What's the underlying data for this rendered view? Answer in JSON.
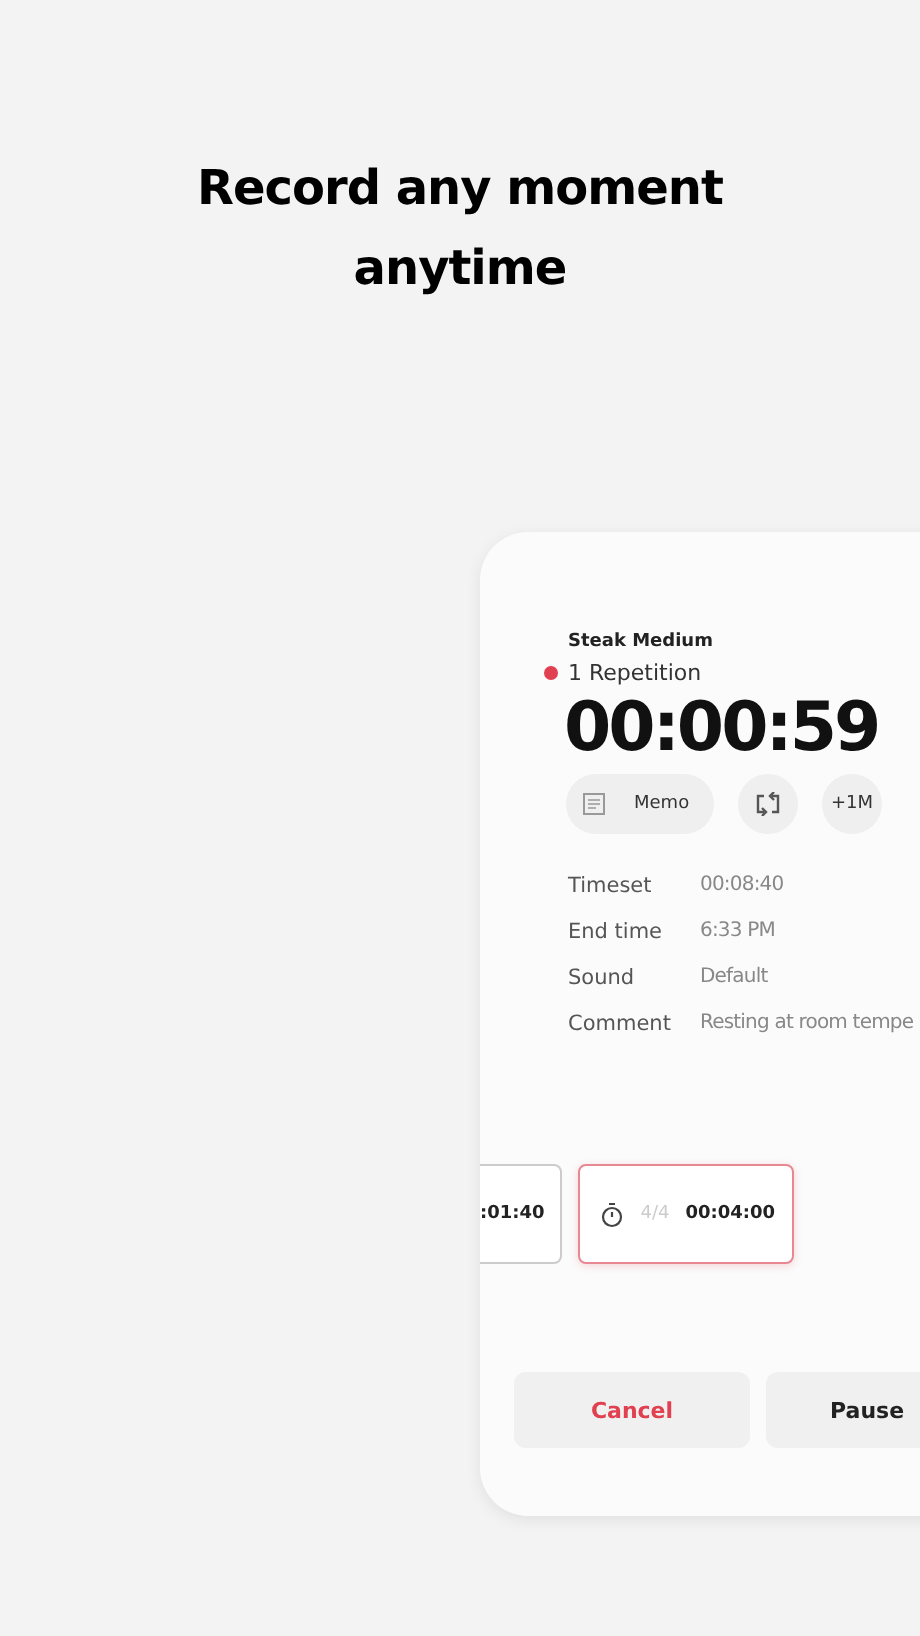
{
  "headline": [
    "Record any moment",
    "anytime"
  ],
  "timer": {
    "name": "Steak Medium",
    "repetition": "1 Repetition",
    "running": true,
    "time": "00:00:59"
  },
  "actions": [
    {
      "kind": "memo",
      "label": "Memo"
    },
    {
      "kind": "repeat"
    },
    {
      "kind": "text",
      "label": "+1M"
    }
  ],
  "details": [
    {
      "label": "Timeset",
      "value": "00:08:40"
    },
    {
      "label": "End time",
      "value": "6:33 PM"
    },
    {
      "label": "Sound",
      "value": "Default"
    },
    {
      "label": "Comment",
      "value": "Resting at room tempe"
    }
  ],
  "steps": [
    {
      "selected": false,
      "time": ":01:40"
    },
    {
      "selected": true,
      "count": "4/4",
      "time": "00:04:00"
    }
  ],
  "buttons": [
    {
      "kind": "cancel",
      "label": "Cancel"
    },
    {
      "kind": "primary",
      "label": "Pause"
    }
  ]
}
